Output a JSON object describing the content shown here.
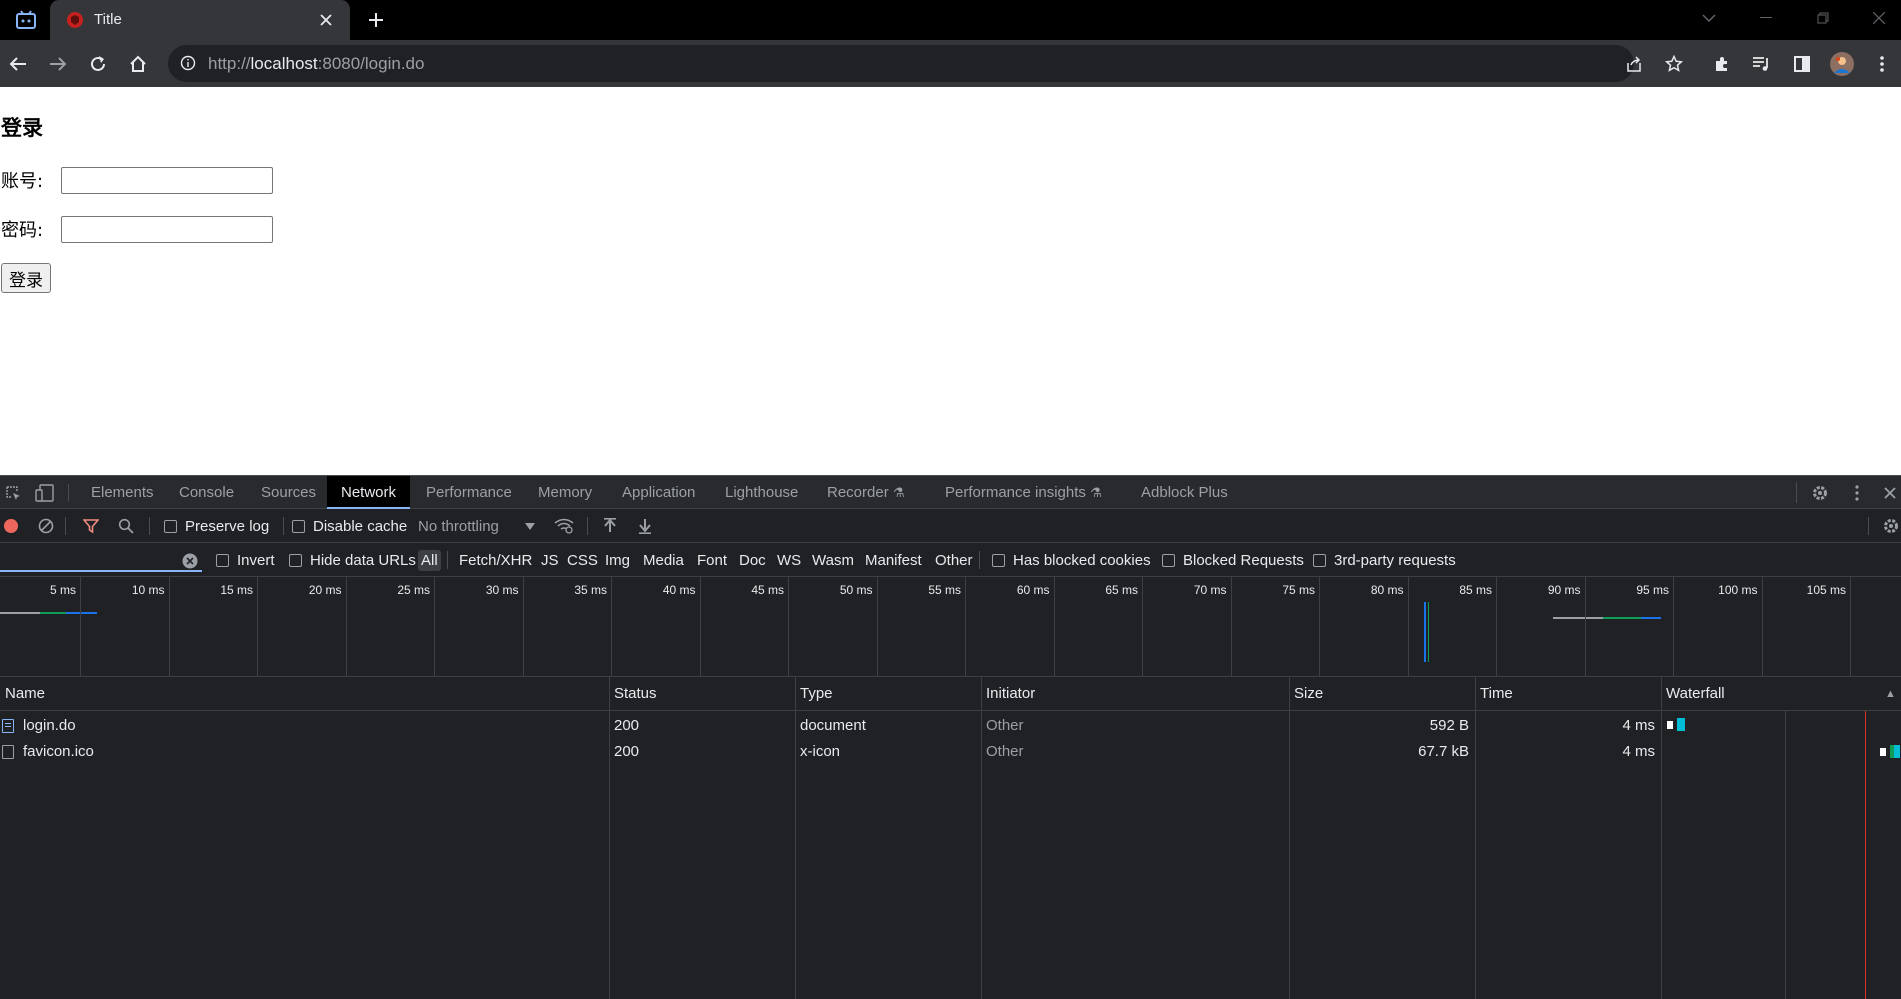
{
  "browser": {
    "tab_title": "Title",
    "url_prefix": "http://",
    "url_host": "localhost",
    "url_rest": ":8080/login.do"
  },
  "page": {
    "heading": "登录",
    "username_label": "账号:",
    "password_label": "密码:",
    "username_value": "",
    "password_value": "",
    "login_button": "登录"
  },
  "devtools": {
    "tabs": [
      "Elements",
      "Console",
      "Sources",
      "Network",
      "Performance",
      "Memory",
      "Application",
      "Lighthouse",
      "Recorder",
      "Performance insights",
      "Adblock Plus"
    ],
    "active_tab": "Network",
    "toolbar": {
      "preserve_log": "Preserve log",
      "disable_cache": "Disable cache",
      "throttling": "No throttling"
    },
    "filters": {
      "invert": "Invert",
      "hide_data_urls": "Hide data URLs",
      "types": [
        "All",
        "Fetch/XHR",
        "JS",
        "CSS",
        "Img",
        "Media",
        "Font",
        "Doc",
        "WS",
        "Wasm",
        "Manifest",
        "Other"
      ],
      "active_type": "All",
      "has_blocked_cookies": "Has blocked cookies",
      "blocked_requests": "Blocked Requests",
      "third_party": "3rd-party requests"
    },
    "overview_ticks": [
      "5 ms",
      "10 ms",
      "15 ms",
      "20 ms",
      "25 ms",
      "30 ms",
      "35 ms",
      "40 ms",
      "45 ms",
      "50 ms",
      "55 ms",
      "60 ms",
      "65 ms",
      "70 ms",
      "75 ms",
      "80 ms",
      "85 ms",
      "90 ms",
      "95 ms",
      "100 ms",
      "105 ms"
    ],
    "columns": {
      "name": "Name",
      "status": "Status",
      "type": "Type",
      "initiator": "Initiator",
      "size": "Size",
      "time": "Time",
      "waterfall": "Waterfall"
    },
    "requests": [
      {
        "name": "login.do",
        "status": "200",
        "type": "document",
        "initiator": "Other",
        "size": "592 B",
        "time": "4 ms"
      },
      {
        "name": "favicon.ico",
        "status": "200",
        "type": "x-icon",
        "initiator": "Other",
        "size": "67.7 kB",
        "time": "4 ms"
      }
    ]
  },
  "colors": {
    "accent": "#8ab4f8",
    "record": "#ee675c",
    "filter": "#f28b82",
    "bar_blue": "#1a73e8",
    "bar_teal": "#00bcd4",
    "bar_green": "#0f9d58",
    "load_line": "#d93025"
  }
}
